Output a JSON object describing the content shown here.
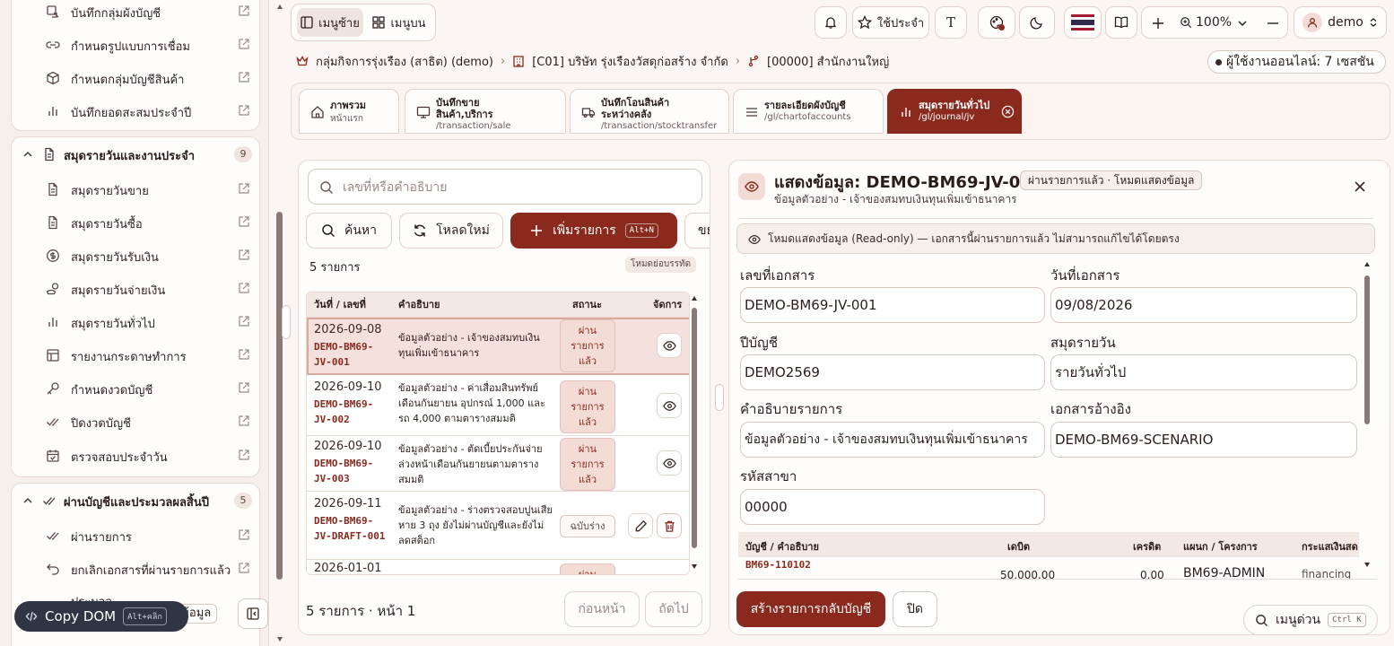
{
  "sidebar": {
    "group1_items": [
      {
        "label": "บันทึกกลุ่มผังบัญชี",
        "icon": "group-chart-icon"
      },
      {
        "label": "กำหนดรูปแบบการเชื่อม",
        "icon": "link-icon"
      },
      {
        "label": "กำหนดกลุ่มบัญชีสินค้า",
        "icon": "box-icon"
      },
      {
        "label": "บันทึกยอดสะสมประจำปี",
        "icon": "bar-chart-icon"
      }
    ],
    "group2": {
      "title": "สมุดรายวันและงานประจำ",
      "count": "9",
      "items": [
        {
          "label": "สมุดรายวันขาย",
          "icon": "document-icon"
        },
        {
          "label": "สมุดรายวันซื้อ",
          "icon": "document-icon"
        },
        {
          "label": "สมุดรายวันรับเงิน",
          "icon": "coin-icon"
        },
        {
          "label": "สมุดรายวันจ่ายเงิน",
          "icon": "hand-coin-icon"
        },
        {
          "label": "สมุดรายวันทั่วไป",
          "icon": "bar-chart-icon"
        },
        {
          "label": "รายงานกระดาษทำการ",
          "icon": "table-icon"
        },
        {
          "label": "กำหนดงวดบัญชี",
          "icon": "key-icon"
        },
        {
          "label": "ปิดงวดบัญชี",
          "icon": "double-check-icon"
        },
        {
          "label": "ตรวจสอบประจำวัน",
          "icon": "calendar-check-icon"
        }
      ]
    },
    "group3": {
      "title": "ผ่านบัญชีและประมวลผลสิ้นปี",
      "count": "5",
      "items": [
        {
          "label": "ผ่านรายการ",
          "icon": "double-check-icon"
        },
        {
          "label": "ยกเลิกเอกสารที่ผ่านรายการแล้ว",
          "icon": "undo-icon"
        },
        {
          "label": "ประมวล",
          "icon": ""
        }
      ],
      "partial_tail": "ข้อมูล"
    }
  },
  "topbar": {
    "menu_left": "เมนูซ้าย",
    "menu_top": "เมนูบน",
    "history_label": "ใช้ประจำ",
    "text_toggle": "T",
    "zoom_label": "100%",
    "user_label": "demo"
  },
  "breadcrumb": {
    "group": "กลุ่มกิจการรุ่งเรือง (สาธิต) (demo)",
    "company": "[C01] บริษัท รุ่งเรืองวัสดุก่อสร้าง จำกัด",
    "branch": "[00000] สำนักงานใหญ่",
    "online": "ผู้ใช้งานออนไลน์: 7 เซสชัน"
  },
  "tabs": [
    {
      "title": "ภาพรวม",
      "sub": "หน้าแรก",
      "path": ""
    },
    {
      "title": "บันทึกขาย",
      "title2": "สินค้า,บริการ",
      "path": "/transaction/sale"
    },
    {
      "title": "บันทึกโอนสินค้า",
      "title2": "ระหว่างคลัง",
      "path": "/transaction/stocktransfer"
    },
    {
      "title": "รายละเอียดผังบัญชี",
      "path": "/gl/chartofaccounts"
    },
    {
      "title": "สมุดรายวันทั่วไป",
      "path": "/gl/journal/jv"
    }
  ],
  "list": {
    "search_placeholder": "เลขที่หรือคำอธิบาย",
    "search_btn": "ค้นหา",
    "reload_btn": "โหลดใหม่",
    "add_btn": "เพิ่มรายการ",
    "add_kbd": "Alt+N",
    "expand_btn": "ขยาย",
    "count_label": "5 รายการ",
    "compact_label": "โหมดย่อบรรทัด",
    "columns": {
      "date": "วันที่ / เลขที่",
      "desc": "คำอธิบาย",
      "status": "สถานะ",
      "actions": "จัดการ"
    },
    "rows": [
      {
        "date": "2026-09-08",
        "docno": "DEMO-BM69-JV-001",
        "desc": "ข้อมูลตัวอย่าง - เจ้าของสมทบเงินทุนเพิ่มเข้าธนาคาร",
        "status": "ผ่านรายการแล้ว"
      },
      {
        "date": "2026-09-10",
        "docno": "DEMO-BM69-JV-002",
        "desc": "ข้อมูลตัวอย่าง - ค่าเสื่อมสินทรัพย์เดือนกันยายน อุปกรณ์ 1,000 และรถ 4,000 ตามตารางสมมติ",
        "status": "ผ่านรายการแล้ว"
      },
      {
        "date": "2026-09-10",
        "docno": "DEMO-BM69-JV-003",
        "desc": "ข้อมูลตัวอย่าง - ตัดเบี้ยประกันจ่ายล่วงหน้าเดือนกันยายนตามตารางสมมติ",
        "status": "ผ่านรายการแล้ว"
      },
      {
        "date": "2026-09-11",
        "docno": "DEMO-BM69-JV-DRAFT-001",
        "desc": "ข้อมูลตัวอย่าง - ร่างตรวจสอบปูนเสียหาย 3 ถุง ยังไม่ผ่านบัญชีและยังไม่ลดสต็อก",
        "status": "ฉบับร่าง"
      },
      {
        "date": "2026-01-01",
        "docno": "",
        "desc": "",
        "status": "ผ่าน"
      }
    ],
    "pager_label": "5 รายการ · หน้า 1",
    "prev_btn": "ก่อนหน้า",
    "next_btn": "ถัดไป"
  },
  "detail": {
    "title": "แสดงข้อมูล: DEMO-BM69-JV-001",
    "badge": "ผ่านรายการแล้ว · โหมดแสดงข้อมูล",
    "subtitle": "ข้อมูลตัวอย่าง - เจ้าของสมทบเงินทุนเพิ่มเข้าธนาคาร",
    "readonly_notice": "โหมดแสดงข้อมูล (Read-only) — เอกสารนี้ผ่านรายการแล้ว ไม่สามารถแก้ไขได้โดยตรง",
    "fields": {
      "docno_label": "เลขที่เอกสาร",
      "docno": "DEMO-BM69-JV-001",
      "docdate_label": "วันที่เอกสาร",
      "docdate": "09/08/2026",
      "year_label": "ปีบัญชี",
      "year": "DEMO2569",
      "journal_label": "สมุดรายวัน",
      "journal": "รายวันทั่วไป",
      "desc_label": "คำอธิบายรายการ",
      "desc": "ข้อมูลตัวอย่าง - เจ้าของสมทบเงินทุนเพิ่มเข้าธนาคาร",
      "ref_label": "เอกสารอ้างอิง",
      "ref": "DEMO-BM69-SCENARIO",
      "branch_label": "รหัสสาขา",
      "branch": "00000"
    },
    "lines_columns": {
      "account": "บัญชี / คำอธิบาย",
      "debit": "เดบิต",
      "credit": "เครดิต",
      "dept": "แผนก / โครงการ",
      "cashflow": "กระแสเงินสด"
    },
    "line": {
      "account": "BM69-110102",
      "debit": "50,000.00",
      "credit": "0.00",
      "dept": "BM69-ADMIN",
      "cashflow": "financing"
    },
    "reverse_btn": "สร้างรายการกลับบัญชี",
    "close_btn": "ปิด"
  },
  "floating": {
    "copy_dom": "Copy DOM",
    "copy_dom_kbd": "Alt+คลิก",
    "quick_menu": "เมนูด่วน",
    "quick_menu_kbd": "Ctrl K"
  },
  "colors": {
    "accent": "#8a2a1e",
    "accent_soft": "#f3dcd6",
    "bg": "#fbf6f4"
  }
}
